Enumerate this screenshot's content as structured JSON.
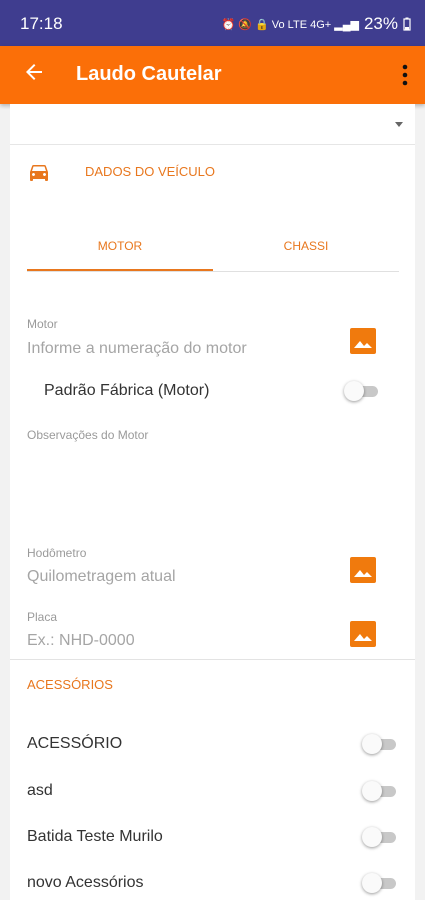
{
  "status_bar": {
    "time": "17:18",
    "indicators": "⏰ 🔕 🔒 Vo LTE 4G+ ▂▄▆",
    "battery": "23%"
  },
  "app_bar": {
    "title": "Laudo Cautelar",
    "icons": [
      "back-arrow-icon",
      "more-vert-icon"
    ]
  },
  "vehicle_section": {
    "icon": "car-icon",
    "title": "DADOS DO VEÍCULO"
  },
  "tabs": [
    {
      "label": "MOTOR",
      "active": true
    },
    {
      "label": "CHASSI",
      "active": false
    }
  ],
  "motor": {
    "label": "Motor",
    "placeholder": "Informe a numeração do motor",
    "factory_label": "Padrão Fábrica (Motor)",
    "factory_on": false,
    "notes_label": "Observações do Motor",
    "odometer_label": "Hodômetro",
    "odometer_placeholder": "Quilometragem atual",
    "plate_label": "Placa",
    "plate_placeholder": "Ex.: NHD-0000"
  },
  "accessories": {
    "title": "ACESSÓRIOS",
    "items": [
      {
        "label": "ACESSÓRIO",
        "on": false
      },
      {
        "label": "asd",
        "on": false
      },
      {
        "label": "Batida Teste Murilo",
        "on": false
      },
      {
        "label": "novo Acessórios",
        "on": false
      }
    ]
  },
  "colors": {
    "status_bar": "#3f3d8f",
    "app_bar": "#fb6f08",
    "accent": "#e8771e"
  }
}
